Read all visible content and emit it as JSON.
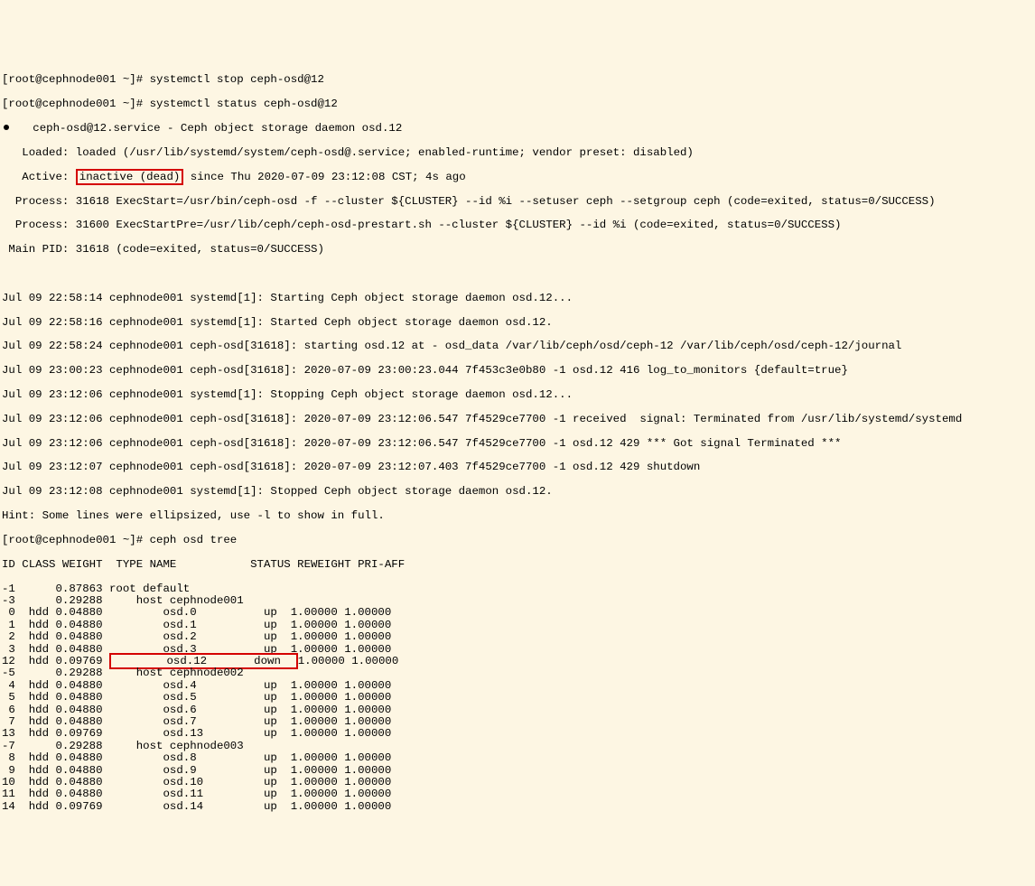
{
  "prompt1": "[root@cephnode001 ~]# systemctl stop ceph-osd@12",
  "prompt2": "[root@cephnode001 ~]# systemctl status ceph-osd@12",
  "svc_header_left": "   ceph-osd@12.service - Ceph object storage daemon osd.12",
  "loaded_label": "   Loaded: ",
  "loaded_value": "loaded (/usr/lib/systemd/system/ceph-osd@.service; enabled-runtime; vendor preset: disabled)",
  "active_label": "   Active: ",
  "active_value": "inactive (dead)",
  "active_tail": " since Thu 2020-07-09 23:12:08 CST; 4s ago",
  "proc1": "  Process: 31618 ExecStart=/usr/bin/ceph-osd -f --cluster ${CLUSTER} --id %i --setuser ceph --setgroup ceph (code=exited, status=0/SUCCESS)",
  "proc2": "  Process: 31600 ExecStartPre=/usr/lib/ceph/ceph-osd-prestart.sh --cluster ${CLUSTER} --id %i (code=exited, status=0/SUCCESS)",
  "mainpid": " Main PID: 31618 (code=exited, status=0/SUCCESS)",
  "blank1": " ",
  "log1": "Jul 09 22:58:14 cephnode001 systemd[1]: Starting Ceph object storage daemon osd.12...",
  "log2": "Jul 09 22:58:16 cephnode001 systemd[1]: Started Ceph object storage daemon osd.12.",
  "log3": "Jul 09 22:58:24 cephnode001 ceph-osd[31618]: starting osd.12 at - osd_data /var/lib/ceph/osd/ceph-12 /var/lib/ceph/osd/ceph-12/journal",
  "log4": "Jul 09 23:00:23 cephnode001 ceph-osd[31618]: 2020-07-09 23:00:23.044 7f453c3e0b80 -1 osd.12 416 log_to_monitors {default=true}",
  "log5": "Jul 09 23:12:06 cephnode001 systemd[1]: Stopping Ceph object storage daemon osd.12...",
  "log6": "Jul 09 23:12:06 cephnode001 ceph-osd[31618]: 2020-07-09 23:12:06.547 7f4529ce7700 -1 received  signal: Terminated from /usr/lib/systemd/systemd",
  "log7": "Jul 09 23:12:06 cephnode001 ceph-osd[31618]: 2020-07-09 23:12:06.547 7f4529ce7700 -1 osd.12 429 *** Got signal Terminated ***",
  "log8": "Jul 09 23:12:07 cephnode001 ceph-osd[31618]: 2020-07-09 23:12:07.403 7f4529ce7700 -1 osd.12 429 shutdown",
  "log9": "Jul 09 23:12:08 cephnode001 systemd[1]: Stopped Ceph object storage daemon osd.12.",
  "hint": "Hint: Some lines were ellipsized, use -l to show in full.",
  "prompt3": "[root@cephnode001 ~]# ceph osd tree",
  "tree_header": "ID CLASS WEIGHT  TYPE NAME           STATUS REWEIGHT PRI-AFF ",
  "chart_data": {
    "type": "table",
    "columns": [
      "ID",
      "CLASS",
      "WEIGHT",
      "TYPE NAME",
      "STATUS",
      "REWEIGHT",
      "PRI-AFF"
    ],
    "rows": [
      {
        "id": "-1",
        "cls": "",
        "weight": "0.87863",
        "name": "root default",
        "status": "",
        "rew": "",
        "pri": ""
      },
      {
        "id": "-3",
        "cls": "",
        "weight": "0.29288",
        "name": "    host cephnode001",
        "status": "",
        "rew": "",
        "pri": ""
      },
      {
        "id": " 0",
        "cls": "hdd",
        "weight": "0.04880",
        "name": "        osd.0",
        "status": "up",
        "rew": "1.00000",
        "pri": "1.00000"
      },
      {
        "id": " 1",
        "cls": "hdd",
        "weight": "0.04880",
        "name": "        osd.1",
        "status": "up",
        "rew": "1.00000",
        "pri": "1.00000"
      },
      {
        "id": " 2",
        "cls": "hdd",
        "weight": "0.04880",
        "name": "        osd.2",
        "status": "up",
        "rew": "1.00000",
        "pri": "1.00000"
      },
      {
        "id": " 3",
        "cls": "hdd",
        "weight": "0.04880",
        "name": "        osd.3",
        "status": "up",
        "rew": "1.00000",
        "pri": "1.00000"
      },
      {
        "id": "12",
        "cls": "hdd",
        "weight": "0.09769",
        "name": "        osd.12",
        "status": "down",
        "rew": "1.00000",
        "pri": "1.00000",
        "hl": true
      },
      {
        "id": "-5",
        "cls": "",
        "weight": "0.29288",
        "name": "    host cephnode002",
        "status": "",
        "rew": "",
        "pri": ""
      },
      {
        "id": " 4",
        "cls": "hdd",
        "weight": "0.04880",
        "name": "        osd.4",
        "status": "up",
        "rew": "1.00000",
        "pri": "1.00000"
      },
      {
        "id": " 5",
        "cls": "hdd",
        "weight": "0.04880",
        "name": "        osd.5",
        "status": "up",
        "rew": "1.00000",
        "pri": "1.00000"
      },
      {
        "id": " 6",
        "cls": "hdd",
        "weight": "0.04880",
        "name": "        osd.6",
        "status": "up",
        "rew": "1.00000",
        "pri": "1.00000"
      },
      {
        "id": " 7",
        "cls": "hdd",
        "weight": "0.04880",
        "name": "        osd.7",
        "status": "up",
        "rew": "1.00000",
        "pri": "1.00000"
      },
      {
        "id": "13",
        "cls": "hdd",
        "weight": "0.09769",
        "name": "        osd.13",
        "status": "up",
        "rew": "1.00000",
        "pri": "1.00000"
      },
      {
        "id": "-7",
        "cls": "",
        "weight": "0.29288",
        "name": "    host cephnode003",
        "status": "",
        "rew": "",
        "pri": ""
      },
      {
        "id": " 8",
        "cls": "hdd",
        "weight": "0.04880",
        "name": "        osd.8",
        "status": "up",
        "rew": "1.00000",
        "pri": "1.00000"
      },
      {
        "id": " 9",
        "cls": "hdd",
        "weight": "0.04880",
        "name": "        osd.9",
        "status": "up",
        "rew": "1.00000",
        "pri": "1.00000"
      },
      {
        "id": "10",
        "cls": "hdd",
        "weight": "0.04880",
        "name": "        osd.10",
        "status": "up",
        "rew": "1.00000",
        "pri": "1.00000"
      },
      {
        "id": "11",
        "cls": "hdd",
        "weight": "0.04880",
        "name": "        osd.11",
        "status": "up",
        "rew": "1.00000",
        "pri": "1.00000"
      },
      {
        "id": "14",
        "cls": "hdd",
        "weight": "0.09769",
        "name": "        osd.14",
        "status": "up",
        "rew": "1.00000",
        "pri": "1.00000"
      }
    ]
  },
  "highlight_color": "#d40000"
}
